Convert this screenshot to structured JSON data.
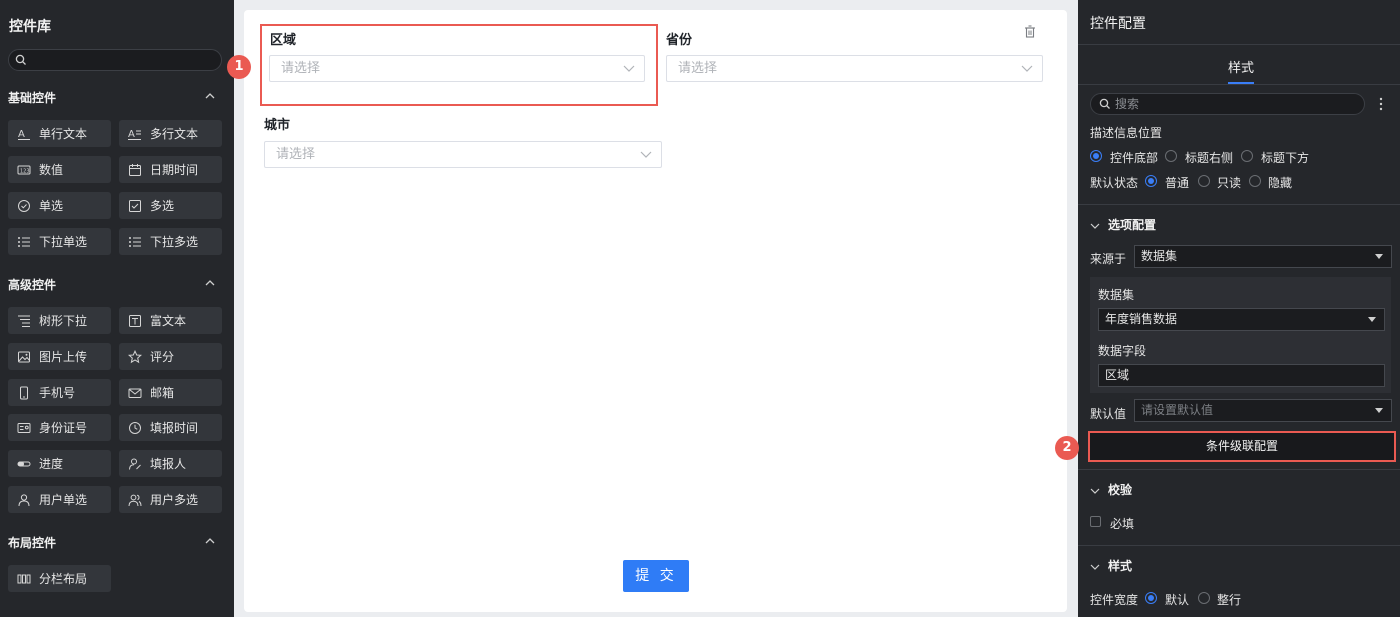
{
  "left": {
    "title": "控件库",
    "search_placeholder": "",
    "groups": [
      {
        "title": "基础控件",
        "items": [
          "单行文本",
          "多行文本",
          "数值",
          "日期时间",
          "单选",
          "多选",
          "下拉单选",
          "下拉多选"
        ]
      },
      {
        "title": "高级控件",
        "items": [
          "树形下拉",
          "富文本",
          "图片上传",
          "评分",
          "手机号",
          "邮箱",
          "身份证号",
          "填报时间",
          "进度",
          "填报人",
          "用户单选",
          "用户多选"
        ]
      },
      {
        "title": "布局控件",
        "items": [
          "分栏布局"
        ]
      }
    ]
  },
  "canvas": {
    "fields": [
      {
        "label": "区域",
        "placeholder": "请选择"
      },
      {
        "label": "省份",
        "placeholder": "请选择"
      },
      {
        "label": "城市",
        "placeholder": "请选择"
      }
    ],
    "submit_label": "提 交",
    "annotation_1": "1",
    "annotation_2": "2"
  },
  "right": {
    "title": "控件配置",
    "tab": "样式",
    "search_placeholder": "搜索",
    "desc_position_label": "描述信息位置",
    "desc_options": [
      "控件底部",
      "标题右侧",
      "标题下方"
    ],
    "default_state_label": "默认状态",
    "state_options": [
      "普通",
      "只读",
      "隐藏"
    ],
    "options_section": "选项配置",
    "source_label": "来源于",
    "source_value": "数据集",
    "dataset_label": "数据集",
    "dataset_value": "年度销售数据",
    "field_label": "数据字段",
    "field_value": "区域",
    "default_value_label": "默认值",
    "default_value_placeholder": "请设置默认值",
    "cascade_button": "条件级联配置",
    "validation_section": "校验",
    "required_label": "必填",
    "style_section": "样式",
    "width_label": "控件宽度",
    "width_options": [
      "默认",
      "整行"
    ]
  },
  "colors": {
    "accent": "#2f7cf6",
    "highlight": "#ea5a52",
    "panel": "#25272b"
  }
}
